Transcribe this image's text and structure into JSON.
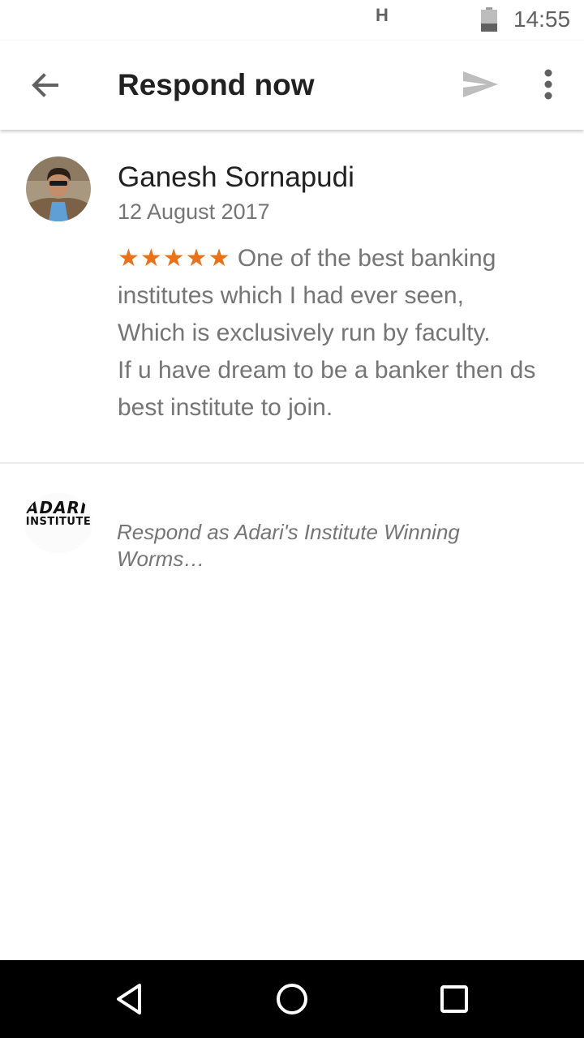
{
  "status_bar": {
    "network": "H",
    "time": "14:55",
    "icons": [
      "network-type-icon",
      "battery-icon"
    ]
  },
  "app_bar": {
    "title": "Respond now",
    "icons": [
      "back-arrow-icon",
      "send-icon",
      "more-vert-icon"
    ]
  },
  "review": {
    "reviewer_name": "Ganesh Sornapudi",
    "date": "12 August 2017",
    "rating": 5,
    "stars_text": "★★★★★",
    "text_lines": [
      "One of the best banking",
      "institutes which I had ever seen,",
      "Which is exclusively run by faculty.",
      "If u have dream to be a banker then ds",
      "best institute to join."
    ]
  },
  "respond": {
    "logo_text_top": "ADARI'S",
    "logo_text_bottom": "INSTITUTE",
    "placeholder_lines": [
      "Respond as Adari's Institute Winning",
      "Worms…"
    ]
  },
  "nav_bar": {
    "icons": [
      "back-triangle-icon",
      "home-circle-icon",
      "recents-square-icon"
    ]
  },
  "colors": {
    "star": "#e8711a",
    "secondary_text": "#757575",
    "primary_text": "#212121",
    "icon_gray": "#616161",
    "send_icon": "#bdbdbd"
  }
}
